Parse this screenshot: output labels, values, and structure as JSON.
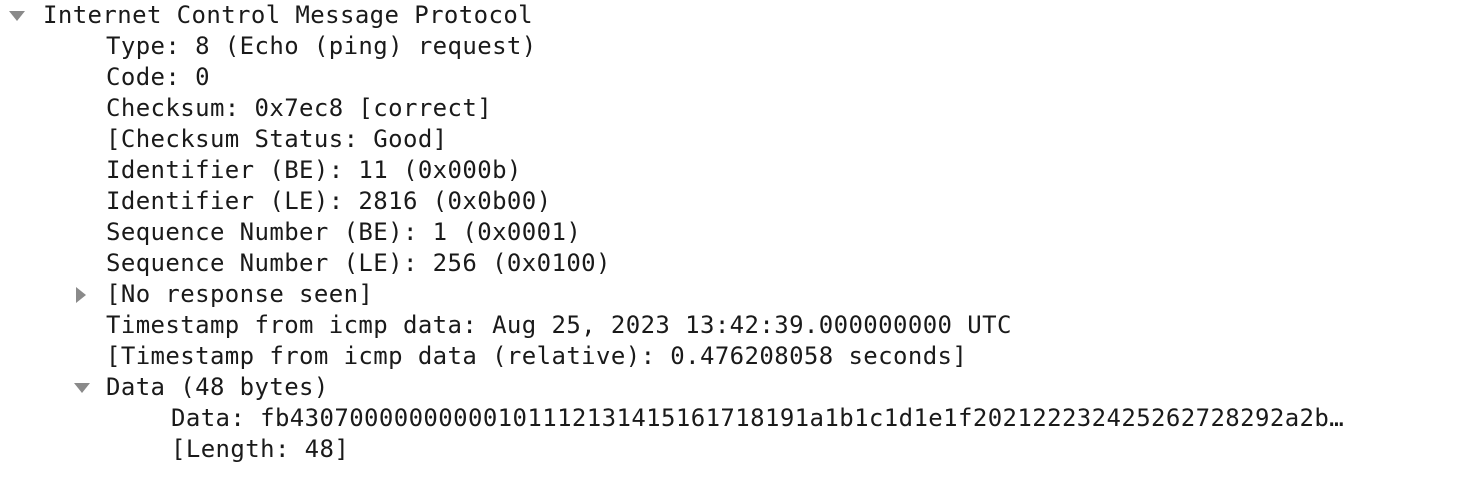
{
  "tree": {
    "root": {
      "label": "Internet Control Message Protocol",
      "expanded": true
    },
    "fields": {
      "type": "Type: 8 (Echo (ping) request)",
      "code": "Code: 0",
      "checksum": "Checksum: 0x7ec8 [correct]",
      "checksum_status": "[Checksum Status: Good]",
      "identifier_be": "Identifier (BE): 11 (0x000b)",
      "identifier_le": "Identifier (LE): 2816 (0x0b00)",
      "seq_be": "Sequence Number (BE): 1 (0x0001)",
      "seq_le": "Sequence Number (LE): 256 (0x0100)",
      "no_response": {
        "label": "[No response seen]",
        "expanded": false
      },
      "timestamp": "Timestamp from icmp data: Aug 25, 2023 13:42:39.000000000 UTC",
      "timestamp_relative": "[Timestamp from icmp data (relative): 0.476208058 seconds]",
      "data_node": {
        "label": "Data (48 bytes)",
        "expanded": true,
        "children": {
          "data": "Data: fb43070000000000101112131415161718191a1b1c1d1e1f202122232425262728292a2b…",
          "length": "[Length: 48]"
        }
      }
    }
  },
  "colors": {
    "text": "#1a1a1a",
    "toggle": "#8a8a8a",
    "background": "#ffffff"
  },
  "icons": {
    "expanded": "triangle-down-icon",
    "collapsed": "triangle-right-icon"
  }
}
